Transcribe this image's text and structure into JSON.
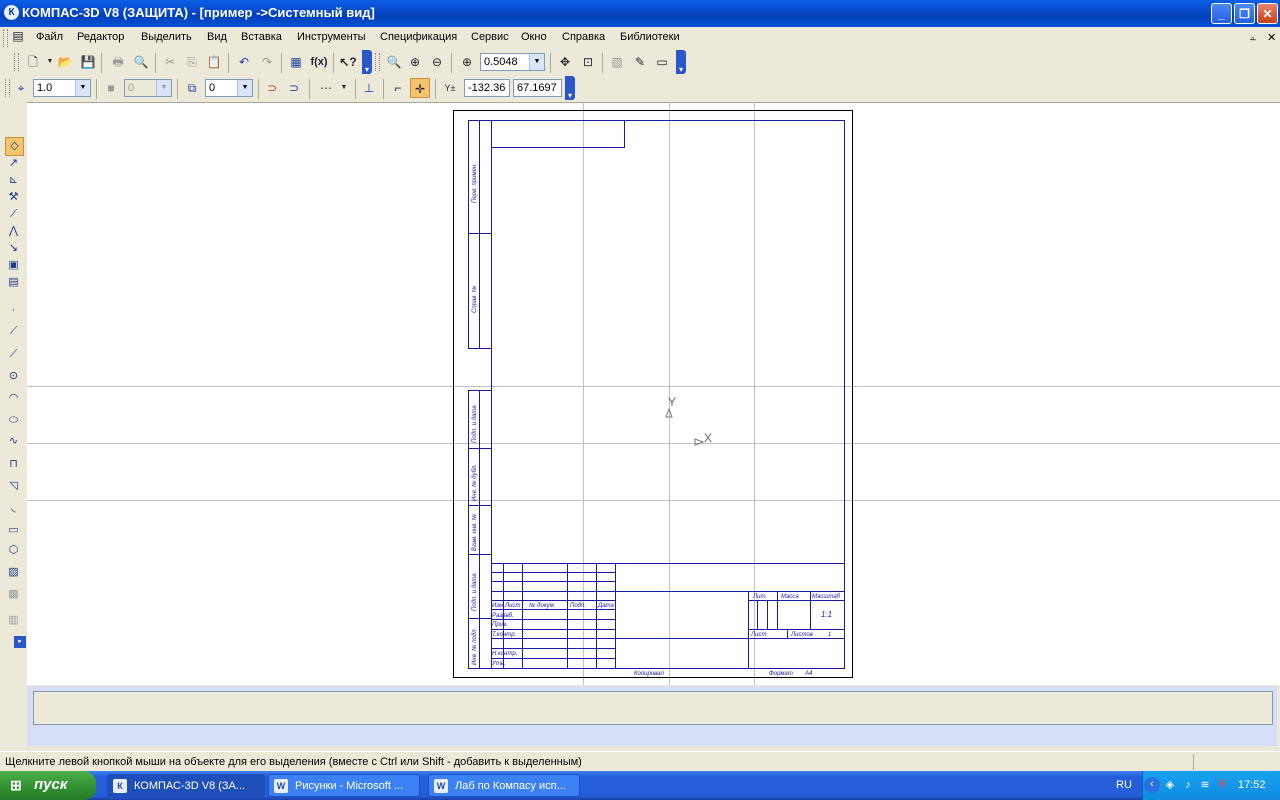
{
  "window": {
    "title": "КОМПАС-3D V8 (ЗАЩИТА) - [пример ->Системный вид]",
    "app_icon": "kompas-logo-icon"
  },
  "menu": {
    "items": [
      "Файл",
      "Редактор",
      "Выделить",
      "Вид",
      "Вставка",
      "Инструменты",
      "Спецификация",
      "Сервис",
      "Окно",
      "Справка",
      "Библиотеки"
    ]
  },
  "toolbar": {
    "zoom_value": "0.5048",
    "step_value": "1.0",
    "layer_value": "0",
    "style_value": "0",
    "coord_x": "-132.36",
    "coord_y": "67.1697",
    "coord_label": "Y±"
  },
  "drawing": {
    "axis_y": "Y",
    "axis_x": "X",
    "side_labels": [
      "Перв. примен.",
      "Справ. №",
      "Подп. и дата",
      "Инв. № дубл.",
      "Взам. инв. №",
      "Подп. и дата",
      "Инв. № подл."
    ],
    "stamp": {
      "rows": [
        "Изм.",
        "Лист",
        "№ докум.",
        "Подп.",
        "Дата"
      ],
      "left_labels": [
        "Разраб.",
        "Пров.",
        "Т.контр.",
        "Н.контр.",
        "Утв."
      ],
      "lit": "Лит.",
      "massa": "Масса",
      "masshtab": "Масштаб",
      "scale_value": "1:1",
      "list": "Лист",
      "listov": "Листов",
      "listov_value": "1",
      "kopiroval": "Копировал",
      "format": "Формат",
      "format_value": "А4"
    }
  },
  "status": {
    "message": "Щелкните левой кнопкой мыши на объекте для его выделения (вместе с Ctrl или Shift - добавить к выделенным)"
  },
  "taskbar": {
    "start": "пуск",
    "tasks": [
      "КОМПАС-3D V8 (ЗА...",
      "Рисунки - Microsoft ...",
      "Лаб по Компасу исп..."
    ],
    "lang": "RU",
    "clock": "17:52"
  }
}
